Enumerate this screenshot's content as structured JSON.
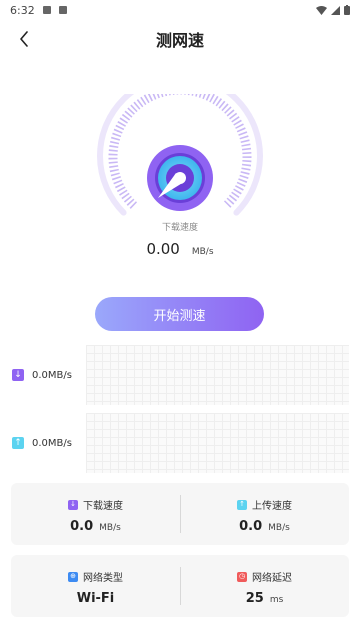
{
  "status_bar": {
    "time": "6:32"
  },
  "header": {
    "title": "测网速"
  },
  "gauge": {
    "label": "下载速度",
    "value": "0.00",
    "unit": "MB/s"
  },
  "start_button": {
    "label": "开始测速"
  },
  "download_rate": {
    "value": "0.0MB/s"
  },
  "upload_rate": {
    "value": "0.0MB/s"
  },
  "stats": {
    "download": {
      "label": "下载速度",
      "value": "0.0",
      "unit": "MB/s"
    },
    "upload": {
      "label": "上传速度",
      "value": "0.0",
      "unit": "MB/s"
    },
    "network_type": {
      "label": "网络类型",
      "value": "Wi-Fi"
    },
    "latency": {
      "label": "网络延迟",
      "value": "25",
      "unit": "ms"
    }
  },
  "colors": {
    "accent": "#8f63f2",
    "download": "#8f63f2",
    "upload": "#5cd3f0",
    "wifi": "#3d8bf2",
    "latency": "#f05b5b"
  }
}
